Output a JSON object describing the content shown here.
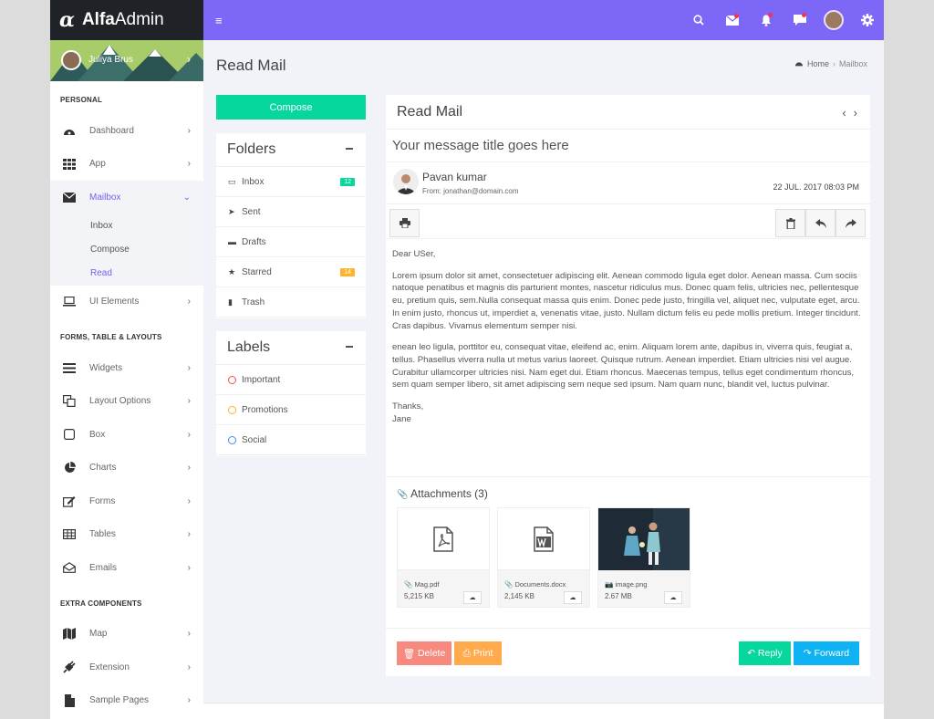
{
  "brand": {
    "alpha": "α",
    "bold": "Alfa",
    "light": "Admin"
  },
  "profile": {
    "name": "Juliya Brus"
  },
  "sidebar": {
    "sections": [
      "PERSONAL",
      "FORMS, TABLE & LAYOUTS",
      "EXTRA COMPONENTS"
    ],
    "items": {
      "dashboard": "Dashboard",
      "app": "App",
      "mailbox": "Mailbox",
      "ui": "UI Elements",
      "widgets": "Widgets",
      "layout": "Layout Options",
      "box": "Box",
      "charts": "Charts",
      "forms": "Forms",
      "tables": "Tables",
      "emails": "Emails",
      "map": "Map",
      "extension": "Extension",
      "sample": "Sample Pages"
    },
    "mailbox_sub": [
      "Inbox",
      "Compose",
      "Read"
    ]
  },
  "page": {
    "title": "Read Mail",
    "breadcrumb": [
      "Home",
      "Mailbox"
    ]
  },
  "compose": "Compose",
  "folders": {
    "title": "Folders",
    "items": [
      {
        "label": "Inbox",
        "badge": "12",
        "badge_color": "#06d79c"
      },
      {
        "label": "Sent"
      },
      {
        "label": "Drafts"
      },
      {
        "label": "Starred",
        "badge": "14",
        "badge_color": "#ffb22b"
      },
      {
        "label": "Trash"
      }
    ]
  },
  "labels": {
    "title": "Labels",
    "items": [
      {
        "label": "Important",
        "color": "#ef5350"
      },
      {
        "label": "Promotions",
        "color": "#ffb22b"
      },
      {
        "label": "Social",
        "color": "#398bf7"
      }
    ]
  },
  "mail": {
    "header": "Read Mail",
    "subject": "Your message title goes here",
    "sender": "Pavan kumar",
    "from": "From: jonathan@domain.com",
    "date": "22 JUL. 2017 08:03 PM",
    "greeting": "Dear USer,",
    "para1": "Lorem ipsum dolor sit amet, consectetuer adipiscing elit. Aenean commodo ligula eget dolor. Aenean massa. Cum sociis natoque penatibus et magnis dis parturient montes, nascetur ridiculus mus. Donec quam felis, ultricies nec, pellentesque eu, pretium quis, sem.Nulla consequat massa quis enim. Donec pede justo, fringilla vel, aliquet nec, vulputate eget, arcu. In enim justo, rhoncus ut, imperdiet a, venenatis vitae, justo. Nullam dictum felis eu pede mollis pretium. Integer tincidunt. Cras dapibus. Vivamus elementum semper nisi.",
    "para2": "enean leo ligula, porttitor eu, consequat vitae, eleifend ac, enim. Aliquam lorem ante, dapibus in, viverra quis, feugiat a, tellus. Phasellus viverra nulla ut metus varius laoreet. Quisque rutrum. Aenean imperdiet. Etiam ultricies nisi vel augue. Curabitur ullamcorper ultricies nisi. Nam eget dui. Etiam rhoncus. Maecenas tempus, tellus eget condimentum rhoncus, sem quam semper libero, sit amet adipiscing sem neque sed ipsum. Nam quam nunc, blandit vel, luctus pulvinar.",
    "thanks": "Thanks,",
    "signature": "Jane",
    "attachments_title": "Attachments (3)",
    "attachments": [
      {
        "name": "Mag.pdf",
        "size": "5,215 KB"
      },
      {
        "name": "Documents.docx",
        "size": "2,145 KB"
      },
      {
        "name": "image.png",
        "size": "2.67 MB"
      }
    ],
    "buttons": {
      "delete": "Delete",
      "print": "Print",
      "reply": "Reply",
      "forward": "Forward"
    }
  },
  "colors": {
    "accent": "#7d67f7",
    "green": "#06d79c",
    "red": "#f8897f",
    "orange": "#ffaa4c",
    "blue": "#0fb2f2"
  }
}
